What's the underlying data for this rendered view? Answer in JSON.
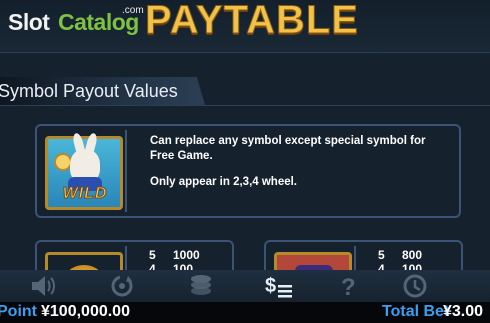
{
  "header": {
    "logo_part1": "Slot",
    "logo_part2": "Catalog",
    "logo_com": ".com",
    "title": "PAYTABLE"
  },
  "section": {
    "label": "Symbol Payout Values"
  },
  "wild": {
    "symbol_name": "wild-rabbit-symbol",
    "symbol_text": "WILD",
    "line1": "Can replace any symbol except special symbol for Free Game.",
    "line2": "Only appear in 2,3,4 wheel."
  },
  "payouts": [
    {
      "symbol": "pocket-watch-symbol",
      "rows": [
        {
          "count": "5",
          "value": "1000"
        },
        {
          "count": "4",
          "value": "100"
        }
      ]
    },
    {
      "symbol": "top-hat-symbol",
      "rows": [
        {
          "count": "5",
          "value": "800"
        },
        {
          "count": "4",
          "value": "100"
        }
      ]
    }
  ],
  "toolbar": {
    "icons": [
      "sound-icon",
      "autoplay-icon",
      "chips-icon",
      "paytable-icon",
      "help-icon",
      "history-icon"
    ],
    "active": "paytable-icon"
  },
  "footer": {
    "point_label": "Point",
    "point_value": "¥100,000.00",
    "bet_label": "Total Bet",
    "bet_value": "¥3.00"
  },
  "colors": {
    "background": "#16212e",
    "card_border": "#3b5377",
    "title_gold": "#f1c24a",
    "footer_label_blue": "#3d9ef0",
    "logo_green": "#7dc241"
  }
}
